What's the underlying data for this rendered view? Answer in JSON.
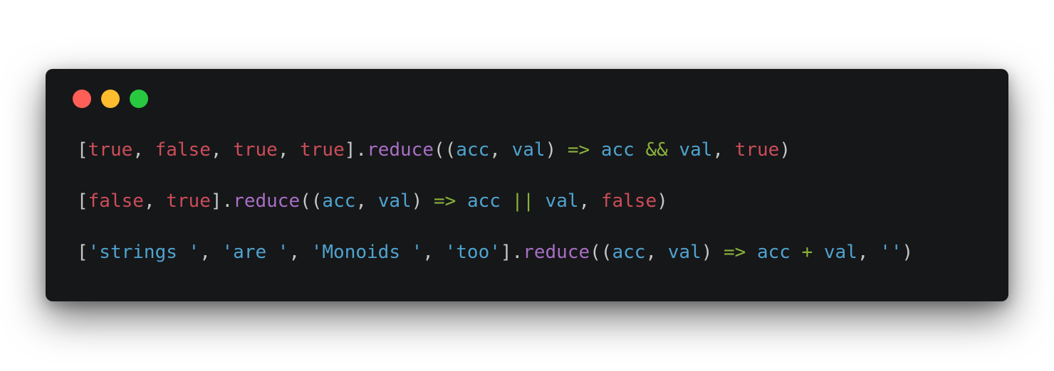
{
  "window": {
    "controls": [
      {
        "name": "close",
        "color": "#ff5f57"
      },
      {
        "name": "minimize",
        "color": "#febc2e"
      },
      {
        "name": "zoom",
        "color": "#28c840"
      }
    ]
  },
  "colors": {
    "punct": "#c5c8c6",
    "literal": "#cc4d58",
    "method": "#a86fc4",
    "ident": "#4fa3cf",
    "operator": "#8ab33c",
    "string": "#4fa3cf"
  },
  "code": {
    "lines": [
      {
        "tokens": [
          {
            "text": "[",
            "kind": "punct"
          },
          {
            "text": "true",
            "kind": "literal"
          },
          {
            "text": ", ",
            "kind": "punct"
          },
          {
            "text": "false",
            "kind": "literal"
          },
          {
            "text": ", ",
            "kind": "punct"
          },
          {
            "text": "true",
            "kind": "literal"
          },
          {
            "text": ", ",
            "kind": "punct"
          },
          {
            "text": "true",
            "kind": "literal"
          },
          {
            "text": "].",
            "kind": "punct"
          },
          {
            "text": "reduce",
            "kind": "method"
          },
          {
            "text": "((",
            "kind": "punct"
          },
          {
            "text": "acc",
            "kind": "ident"
          },
          {
            "text": ", ",
            "kind": "punct"
          },
          {
            "text": "val",
            "kind": "ident"
          },
          {
            "text": ") ",
            "kind": "punct"
          },
          {
            "text": "=>",
            "kind": "operator"
          },
          {
            "text": " ",
            "kind": "punct"
          },
          {
            "text": "acc",
            "kind": "ident"
          },
          {
            "text": " ",
            "kind": "punct"
          },
          {
            "text": "&&",
            "kind": "operator"
          },
          {
            "text": " ",
            "kind": "punct"
          },
          {
            "text": "val",
            "kind": "ident"
          },
          {
            "text": ", ",
            "kind": "punct"
          },
          {
            "text": "true",
            "kind": "literal"
          },
          {
            "text": ")",
            "kind": "punct"
          }
        ]
      },
      {
        "tokens": [
          {
            "text": "[",
            "kind": "punct"
          },
          {
            "text": "false",
            "kind": "literal"
          },
          {
            "text": ", ",
            "kind": "punct"
          },
          {
            "text": "true",
            "kind": "literal"
          },
          {
            "text": "].",
            "kind": "punct"
          },
          {
            "text": "reduce",
            "kind": "method"
          },
          {
            "text": "((",
            "kind": "punct"
          },
          {
            "text": "acc",
            "kind": "ident"
          },
          {
            "text": ", ",
            "kind": "punct"
          },
          {
            "text": "val",
            "kind": "ident"
          },
          {
            "text": ") ",
            "kind": "punct"
          },
          {
            "text": "=>",
            "kind": "operator"
          },
          {
            "text": " ",
            "kind": "punct"
          },
          {
            "text": "acc",
            "kind": "ident"
          },
          {
            "text": " ",
            "kind": "punct"
          },
          {
            "text": "||",
            "kind": "operator"
          },
          {
            "text": " ",
            "kind": "punct"
          },
          {
            "text": "val",
            "kind": "ident"
          },
          {
            "text": ", ",
            "kind": "punct"
          },
          {
            "text": "false",
            "kind": "literal"
          },
          {
            "text": ")",
            "kind": "punct"
          }
        ]
      },
      {
        "tokens": [
          {
            "text": "[",
            "kind": "punct"
          },
          {
            "text": "'strings '",
            "kind": "string"
          },
          {
            "text": ", ",
            "kind": "punct"
          },
          {
            "text": "'are '",
            "kind": "string"
          },
          {
            "text": ", ",
            "kind": "punct"
          },
          {
            "text": "'Monoids '",
            "kind": "string"
          },
          {
            "text": ", ",
            "kind": "punct"
          },
          {
            "text": "'too'",
            "kind": "string"
          },
          {
            "text": "].",
            "kind": "punct"
          },
          {
            "text": "reduce",
            "kind": "method"
          },
          {
            "text": "((",
            "kind": "punct"
          },
          {
            "text": "acc",
            "kind": "ident"
          },
          {
            "text": ", ",
            "kind": "punct"
          },
          {
            "text": "val",
            "kind": "ident"
          },
          {
            "text": ") ",
            "kind": "punct"
          },
          {
            "text": "=>",
            "kind": "operator"
          },
          {
            "text": " ",
            "kind": "punct"
          },
          {
            "text": "acc",
            "kind": "ident"
          },
          {
            "text": " ",
            "kind": "punct"
          },
          {
            "text": "+",
            "kind": "operator"
          },
          {
            "text": " ",
            "kind": "punct"
          },
          {
            "text": "val",
            "kind": "ident"
          },
          {
            "text": ", ",
            "kind": "punct"
          },
          {
            "text": "''",
            "kind": "string"
          },
          {
            "text": ")",
            "kind": "punct"
          }
        ]
      }
    ]
  }
}
